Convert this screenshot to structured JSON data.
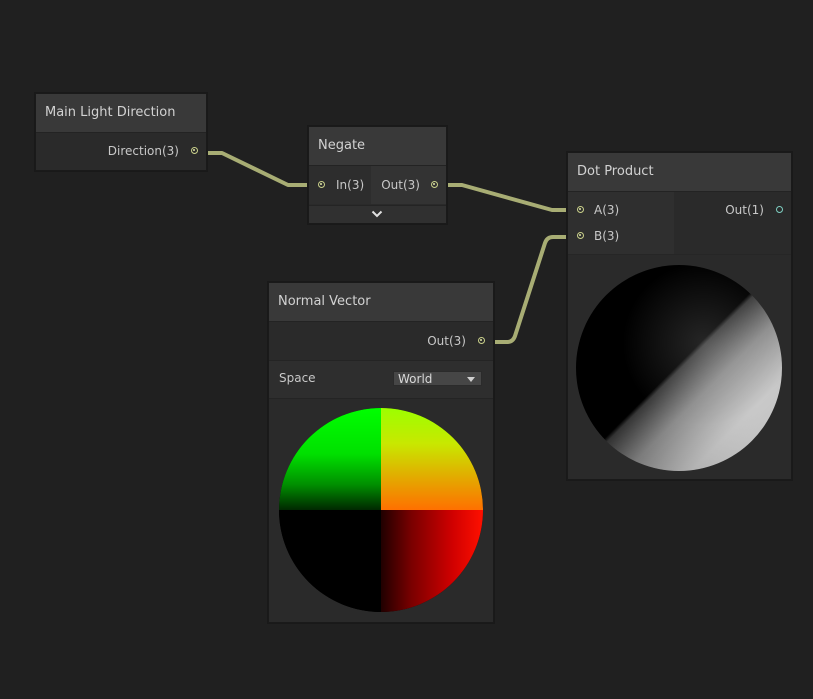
{
  "nodes": {
    "main_light": {
      "title": "Main Light Direction",
      "outputs": [
        {
          "label": "Direction(3)"
        }
      ]
    },
    "negate": {
      "title": "Negate",
      "inputs": [
        {
          "label": "In(3)"
        }
      ],
      "outputs": [
        {
          "label": "Out(3)"
        }
      ],
      "expand_icon": "chevron-down-icon"
    },
    "dot_product": {
      "title": "Dot Product",
      "inputs": [
        {
          "label": "A(3)"
        },
        {
          "label": "B(3)"
        }
      ],
      "outputs": [
        {
          "label": "Out(1)"
        }
      ]
    },
    "normal_vector": {
      "title": "Normal Vector",
      "outputs": [
        {
          "label": "Out(3)"
        }
      ],
      "space_label": "Space",
      "space_value": "World"
    }
  },
  "colors": {
    "background": "#202020",
    "node_body": "#2a2a2a",
    "node_header": "#393939",
    "wire": "#a8ad74",
    "vector3_port": "#c9d08a",
    "vector1_port": "#7fcfc2"
  }
}
